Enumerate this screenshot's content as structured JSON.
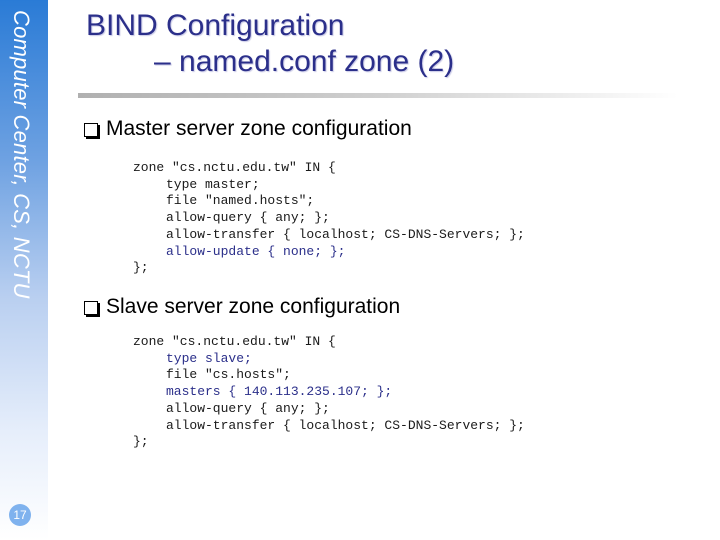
{
  "sidebar": {
    "label": "Computer Center, CS, NCTU",
    "page_number": "17"
  },
  "title": {
    "line1": "BIND Configuration",
    "line2": "– named.conf  zone (2)"
  },
  "sections": [
    {
      "heading": "Master server zone configuration",
      "code": [
        {
          "text": "zone \"cs.nctu.edu.tw\" IN {",
          "indent": false,
          "highlight": false
        },
        {
          "text": "type master;",
          "indent": true,
          "highlight": false
        },
        {
          "text": "file \"named.hosts\";",
          "indent": true,
          "highlight": false
        },
        {
          "text": "allow-query { any; };",
          "indent": true,
          "highlight": false
        },
        {
          "text": "allow-transfer { localhost; CS-DNS-Servers; };",
          "indent": true,
          "highlight": false
        },
        {
          "text": "allow-update { none; };",
          "indent": true,
          "highlight": true
        },
        {
          "text": "};",
          "indent": false,
          "highlight": false
        }
      ]
    },
    {
      "heading": "Slave server zone configuration",
      "code": [
        {
          "text": "zone \"cs.nctu.edu.tw\" IN {",
          "indent": false,
          "highlight": false
        },
        {
          "text": "type slave;",
          "indent": true,
          "highlight": true
        },
        {
          "text": "file \"cs.hosts\";",
          "indent": true,
          "highlight": false
        },
        {
          "text": "masters { 140.113.235.107; };",
          "indent": true,
          "highlight": true
        },
        {
          "text": "allow-query { any; };",
          "indent": true,
          "highlight": false
        },
        {
          "text": "allow-transfer { localhost; CS-DNS-Servers; };",
          "indent": true,
          "highlight": false
        },
        {
          "text": "};",
          "indent": false,
          "highlight": false
        }
      ]
    }
  ],
  "colors": {
    "title": "#2b2f8a",
    "sidebar_top": "#2a7bd6",
    "page_badge": "#7fb2ee",
    "code_highlight": "#2b2f8a"
  }
}
